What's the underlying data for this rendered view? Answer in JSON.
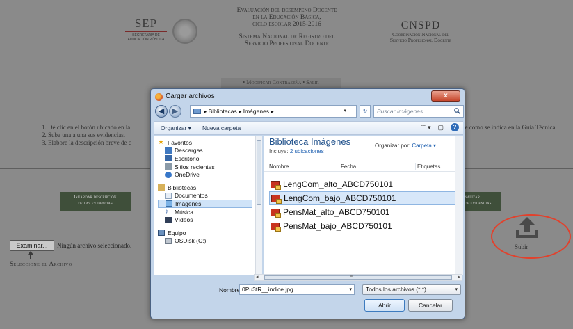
{
  "header": {
    "sep_logo": "SEP",
    "sep_subtitle": "SECRETARÍA DE EDUCACIÓN PÚBLICA",
    "eval_lines": [
      "Evaluación del desempeño Docente",
      "en la Educación Básica,",
      "ciclo escolar 2015-2016"
    ],
    "registry_lines": [
      "Sistema Nacional de Registro del",
      "Servicio Profesional Docente"
    ],
    "cnspd": "CNSPD",
    "cnspd_lines": [
      "Coordinación Nacional del",
      "Servicio Profesional Docente"
    ]
  },
  "nav": {
    "links": "•  Modificar Contraseña  •  Salir"
  },
  "instructions": {
    "items": [
      "1. Dé clic en el botón ubicado en la",
      "2. Suba una a una sus evidencias.",
      "3. Elabore la descripción breve de c"
    ],
    "tail": "te como se indica en la Guía Técnica."
  },
  "buttons": {
    "save_desc": [
      "Guardar descripción",
      "de las evidencias"
    ],
    "finalize": [
      "nalizar",
      "de evidencias"
    ],
    "examinar": "Examinar...",
    "no_file": "Ningún archivo seleccionado.",
    "select_label": "Seleccione el Archivo",
    "subir": "Subir"
  },
  "dialog": {
    "title": "Cargar archivos",
    "close": "x",
    "breadcrumb": "▸ Bibliotecas ▸ Imágenes ▸",
    "refresh": "↻",
    "search_placeholder": "Buscar Imágenes",
    "toolbar": {
      "organize": "Organizar ▾",
      "new_folder": "Nueva carpeta"
    },
    "nav_items": [
      {
        "label": "Favoritos"
      },
      {
        "label": "Descargas"
      },
      {
        "label": "Escritorio"
      },
      {
        "label": "Sitios recientes"
      },
      {
        "label": "OneDrive"
      },
      {
        "label": "Bibliotecas"
      },
      {
        "label": "Documentos"
      },
      {
        "label": "Imágenes"
      },
      {
        "label": "Música"
      },
      {
        "label": "Vídeos"
      },
      {
        "label": "Equipo"
      },
      {
        "label": "OSDisk (C:)"
      }
    ],
    "library_title": "Biblioteca Imágenes",
    "library_includes_prefix": "Incluye:",
    "library_includes_link": "2 ubicaciones",
    "arrange_prefix": "Organizar por:",
    "arrange_value": "Carpeta ▾",
    "columns": [
      "Nombre",
      "Fecha",
      "Etiquetas"
    ],
    "files": [
      {
        "name": "LengCom_alto_ABCD750101",
        "selected": false
      },
      {
        "name": "LengCom_bajo_ABCD750101",
        "selected": true
      },
      {
        "name": "PensMat_alto_ABCD750101",
        "selected": false
      },
      {
        "name": "PensMat_bajo_ABCD750101",
        "selected": false
      }
    ],
    "filename_label": "Nombre:",
    "filename_value": "0Pu3tR__indice.jpg",
    "filter_value": "Todos los archivos (*.*)",
    "open_button": "Abrir",
    "cancel_button": "Cancelar"
  },
  "colors": {
    "highlight_ring": "#e2412c",
    "dialog_frame": "#c3d5ea",
    "selection": "#d7e7f9"
  }
}
